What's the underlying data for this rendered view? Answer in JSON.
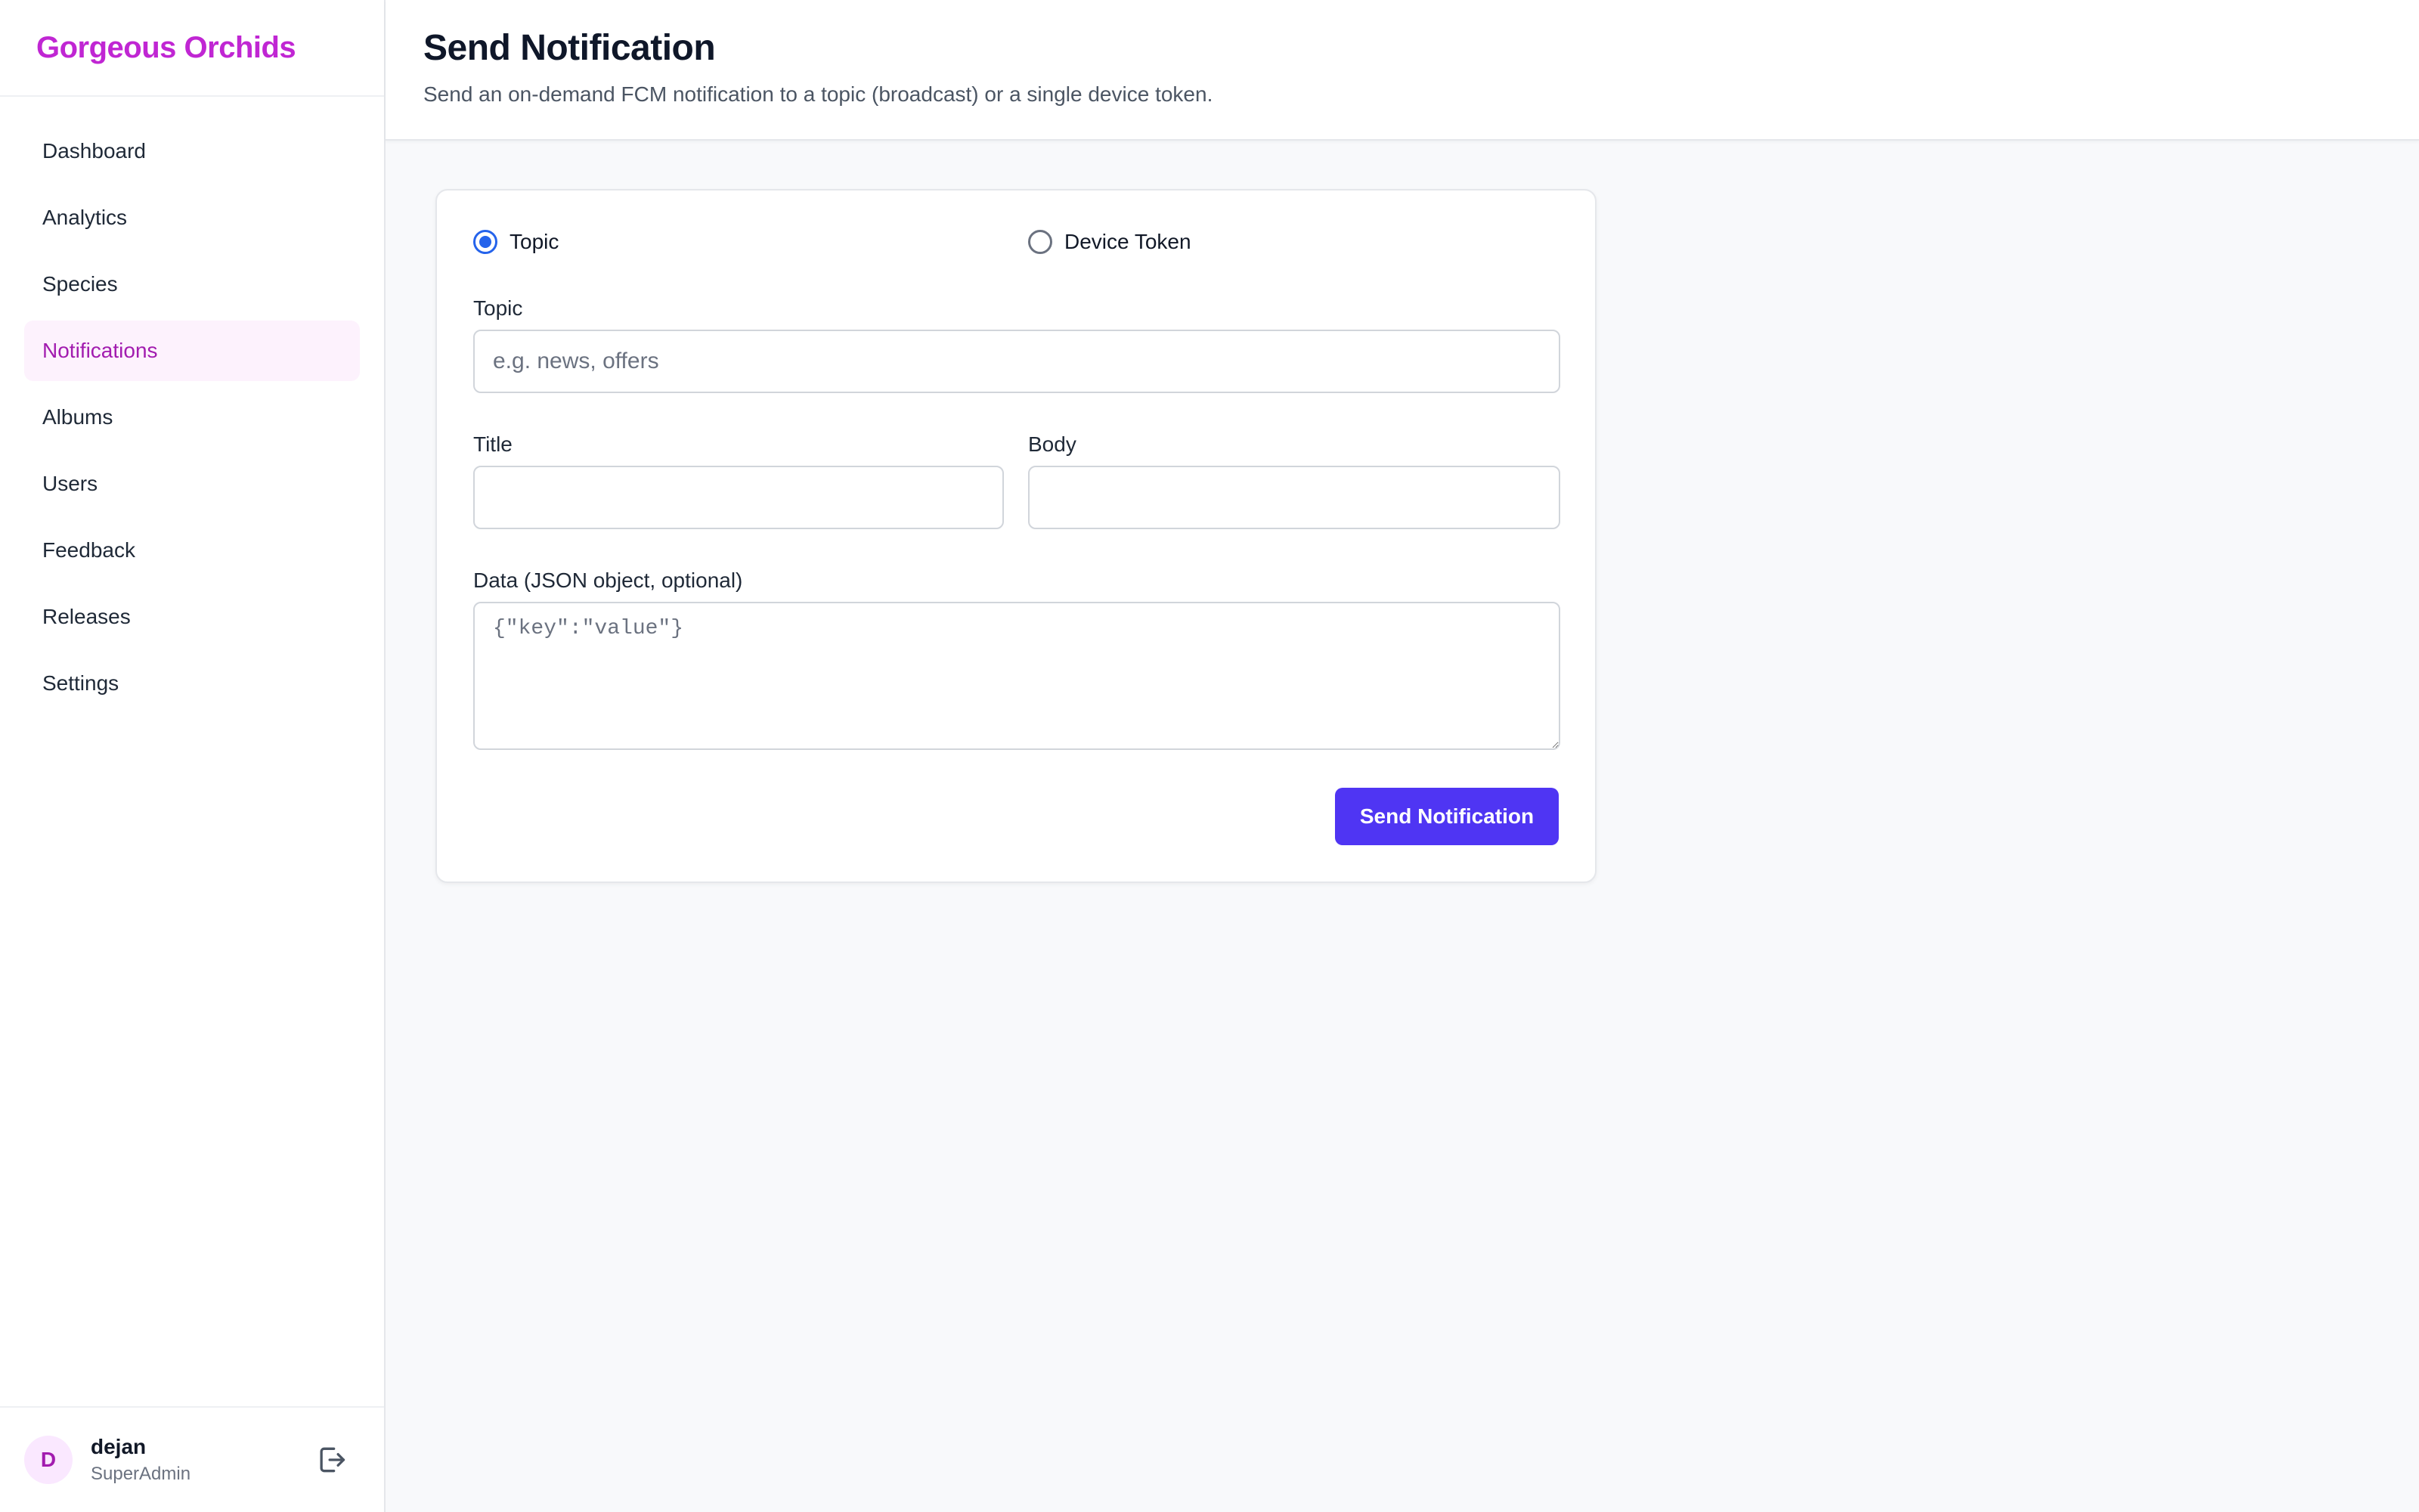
{
  "brand": {
    "name": "Gorgeous Orchids",
    "color": "#c026d3"
  },
  "sidebar": {
    "items": [
      {
        "label": "Dashboard",
        "active": false
      },
      {
        "label": "Analytics",
        "active": false
      },
      {
        "label": "Species",
        "active": false
      },
      {
        "label": "Notifications",
        "active": true
      },
      {
        "label": "Albums",
        "active": false
      },
      {
        "label": "Users",
        "active": false
      },
      {
        "label": "Feedback",
        "active": false
      },
      {
        "label": "Releases",
        "active": false
      },
      {
        "label": "Settings",
        "active": false
      }
    ],
    "user": {
      "initial": "D",
      "name": "dejan",
      "role": "SuperAdmin",
      "logout_icon": "logout-icon"
    }
  },
  "header": {
    "title": "Send Notification",
    "subtitle": "Send an on-demand FCM notification to a topic (broadcast) or a single device token."
  },
  "form": {
    "target_options": [
      {
        "label": "Topic",
        "checked": true
      },
      {
        "label": "Device Token",
        "checked": false
      }
    ],
    "topic": {
      "label": "Topic",
      "value": "",
      "placeholder": "e.g. news, offers"
    },
    "title": {
      "label": "Title",
      "value": "",
      "placeholder": ""
    },
    "body": {
      "label": "Body",
      "value": "",
      "placeholder": ""
    },
    "data": {
      "label": "Data (JSON object, optional)",
      "value": "",
      "placeholder": "{\"key\":\"value\"}"
    },
    "submit_label": "Send Notification",
    "accent_color": "#4f35f3"
  }
}
